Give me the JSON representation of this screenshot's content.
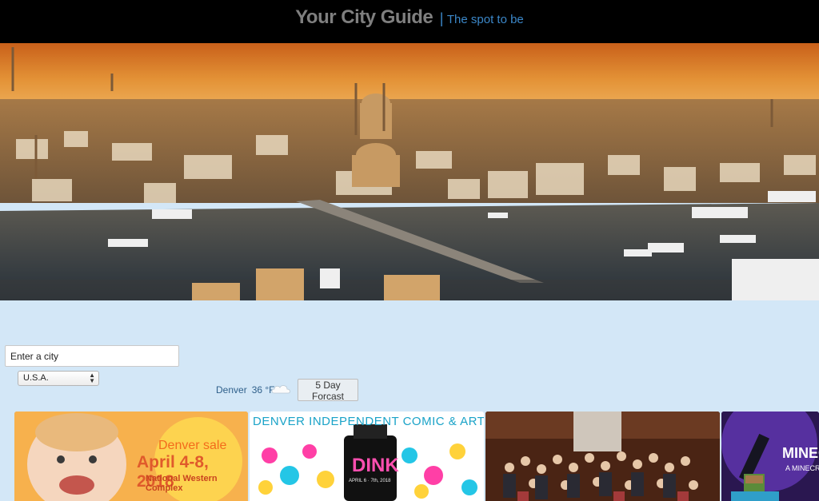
{
  "header": {
    "title": "Your City Guide",
    "separator": "|",
    "tagline": "The spot to be"
  },
  "search": {
    "placeholder": "Enter a city",
    "value": ""
  },
  "country_select": {
    "selected": "U.S.A."
  },
  "weather": {
    "city": "Denver",
    "temperature": "36 °F",
    "condition_icon": "cloud-icon"
  },
  "forecast_button": {
    "label": "5 Day Forcast"
  },
  "events": [
    {
      "line1": "Denver sale",
      "line2": "April 4-8, 2018",
      "line3": "National Western Complex"
    },
    {
      "header": "DENVER INDEPENDENT COMIC & ART EXPO",
      "logo": "DINK",
      "sub": "APRIL 6 · 7th, 2018"
    },
    {
      "image": "group-photo"
    },
    {
      "title": "MINECRAFT",
      "sub": "A MINECRAFT"
    }
  ],
  "colors": {
    "header_bg": "#000000",
    "page_bg": "#d3e7f7",
    "title": "#7f7f7f",
    "tagline": "#3b87c8"
  }
}
